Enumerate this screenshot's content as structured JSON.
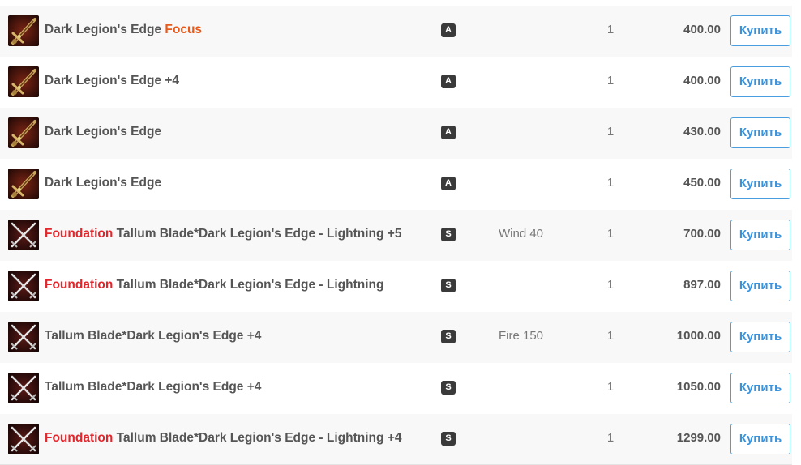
{
  "button_label": "Купить",
  "items": [
    {
      "icon": "dark-legions-edge-icon",
      "prefix": "",
      "name": "Dark Legion's Edge",
      "suffix": "Focus",
      "grade": "A",
      "attribute": "",
      "quantity": "1",
      "price": "400.00"
    },
    {
      "icon": "dark-legions-edge-icon",
      "prefix": "",
      "name": "Dark Legion's Edge +4",
      "suffix": "",
      "grade": "A",
      "attribute": "",
      "quantity": "1",
      "price": "400.00"
    },
    {
      "icon": "dark-legions-edge-icon",
      "prefix": "",
      "name": "Dark Legion's Edge",
      "suffix": "",
      "grade": "A",
      "attribute": "",
      "quantity": "1",
      "price": "430.00"
    },
    {
      "icon": "dark-legions-edge-icon",
      "prefix": "",
      "name": "Dark Legion's Edge",
      "suffix": "",
      "grade": "A",
      "attribute": "",
      "quantity": "1",
      "price": "450.00"
    },
    {
      "icon": "dual-swords-icon",
      "prefix": "Foundation",
      "name": "Tallum Blade*Dark Legion's Edge - Lightning +5",
      "suffix": "",
      "grade": "S",
      "attribute": "Wind 40",
      "quantity": "1",
      "price": "700.00"
    },
    {
      "icon": "dual-swords-icon",
      "prefix": "Foundation",
      "name": "Tallum Blade*Dark Legion's Edge - Lightning",
      "suffix": "",
      "grade": "S",
      "attribute": "",
      "quantity": "1",
      "price": "897.00"
    },
    {
      "icon": "dual-swords-icon",
      "prefix": "",
      "name": "Tallum Blade*Dark Legion's Edge +4",
      "suffix": "",
      "grade": "S",
      "attribute": "Fire 150",
      "quantity": "1",
      "price": "1000.00"
    },
    {
      "icon": "dual-swords-icon",
      "prefix": "",
      "name": "Tallum Blade*Dark Legion's Edge +4",
      "suffix": "",
      "grade": "S",
      "attribute": "",
      "quantity": "1",
      "price": "1050.00"
    },
    {
      "icon": "dual-swords-icon",
      "prefix": "Foundation",
      "name": "Tallum Blade*Dark Legion's Edge - Lightning +4",
      "suffix": "",
      "grade": "S",
      "attribute": "",
      "quantity": "1",
      "price": "1299.00"
    }
  ]
}
